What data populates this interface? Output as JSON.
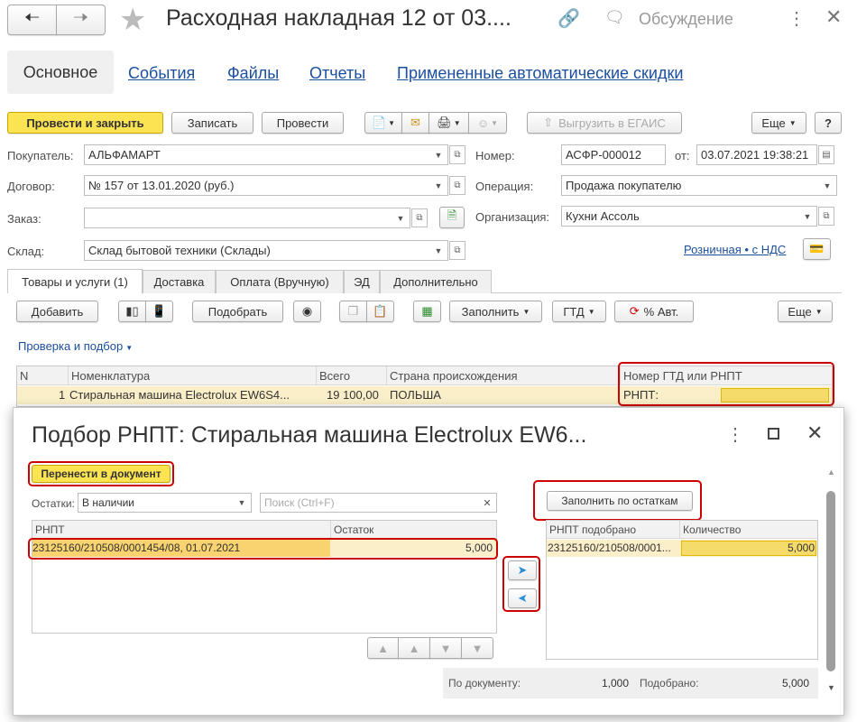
{
  "window": {
    "title": "Расходная накладная 12 от 03....",
    "discussion_label": "Обсуждение"
  },
  "nav_tabs": {
    "main": "Основное",
    "events": "События",
    "files": "Файлы",
    "reports": "Отчеты",
    "discounts": "Примененные автоматические скидки"
  },
  "toolbar": {
    "post_close": "Провести и закрыть",
    "save": "Записать",
    "post": "Провести",
    "egais": "Выгрузить в ЕГАИС",
    "more": "Еще",
    "help": "?"
  },
  "form": {
    "buyer_label": "Покупатель:",
    "buyer_value": "АЛЬФАМАРТ",
    "contract_label": "Договор:",
    "contract_value": "№ 157 от 13.01.2020 (руб.)",
    "order_label": "Заказ:",
    "order_value": "",
    "warehouse_label": "Склад:",
    "warehouse_value": "Склад бытовой техники (Склады)",
    "number_label": "Номер:",
    "number_value": "АСФР-000012",
    "date_label": "от:",
    "date_value": "03.07.2021 19:38:21",
    "operation_label": "Операция:",
    "operation_value": "Продажа покупателю",
    "org_label": "Организация:",
    "org_value": "Кухни Ассоль",
    "vat_link": "Розничная • с НДС"
  },
  "doc_tabs": {
    "goods": "Товары и услуги (1)",
    "delivery": "Доставка",
    "payment": "Оплата (Вручную)",
    "ed": "ЭД",
    "extra": "Дополнительно"
  },
  "goods_toolbar": {
    "add": "Добавить",
    "pick": "Подобрать",
    "fill": "Заполнить",
    "gtd": "ГТД",
    "auto_pct": "% Авт.",
    "more": "Еще"
  },
  "check_link": "Проверка и подбор",
  "goods_table": {
    "headers": {
      "n": "N",
      "item": "Номенклатура",
      "total": "Всего",
      "country": "Страна происхождения",
      "gtd": "Номер ГТД или РНПТ"
    },
    "row": {
      "n": "1",
      "item": "Стиральная машина Electrolux EW6S4...",
      "total": "19 100,00",
      "country": "ПОЛЬША",
      "gtd": "РНПТ:"
    }
  },
  "dialog": {
    "title": "Подбор РНПТ: Стиральная машина Electrolux EW6...",
    "transfer_btn": "Перенести в документ",
    "stock_label": "Остатки:",
    "stock_value": "В наличии",
    "search_placeholder": "Поиск (Ctrl+F)",
    "fill_btn": "Заполнить по остаткам",
    "left_table": {
      "col1": "РНПТ",
      "col2": "Остаток",
      "rows": [
        {
          "rnpt": "23125160/210508/0001454/08, 01.07.2021",
          "rest": "5,000"
        }
      ]
    },
    "right_table": {
      "col1": "РНПТ подобрано",
      "col2": "Количество",
      "rows": [
        {
          "rnpt": "23125160/210508/0001...",
          "qty": "5,000"
        }
      ]
    },
    "footer": {
      "by_doc_label": "По документу:",
      "by_doc_value": "1,000",
      "picked_label": "Подобрано:",
      "picked_value": "5,000"
    }
  }
}
